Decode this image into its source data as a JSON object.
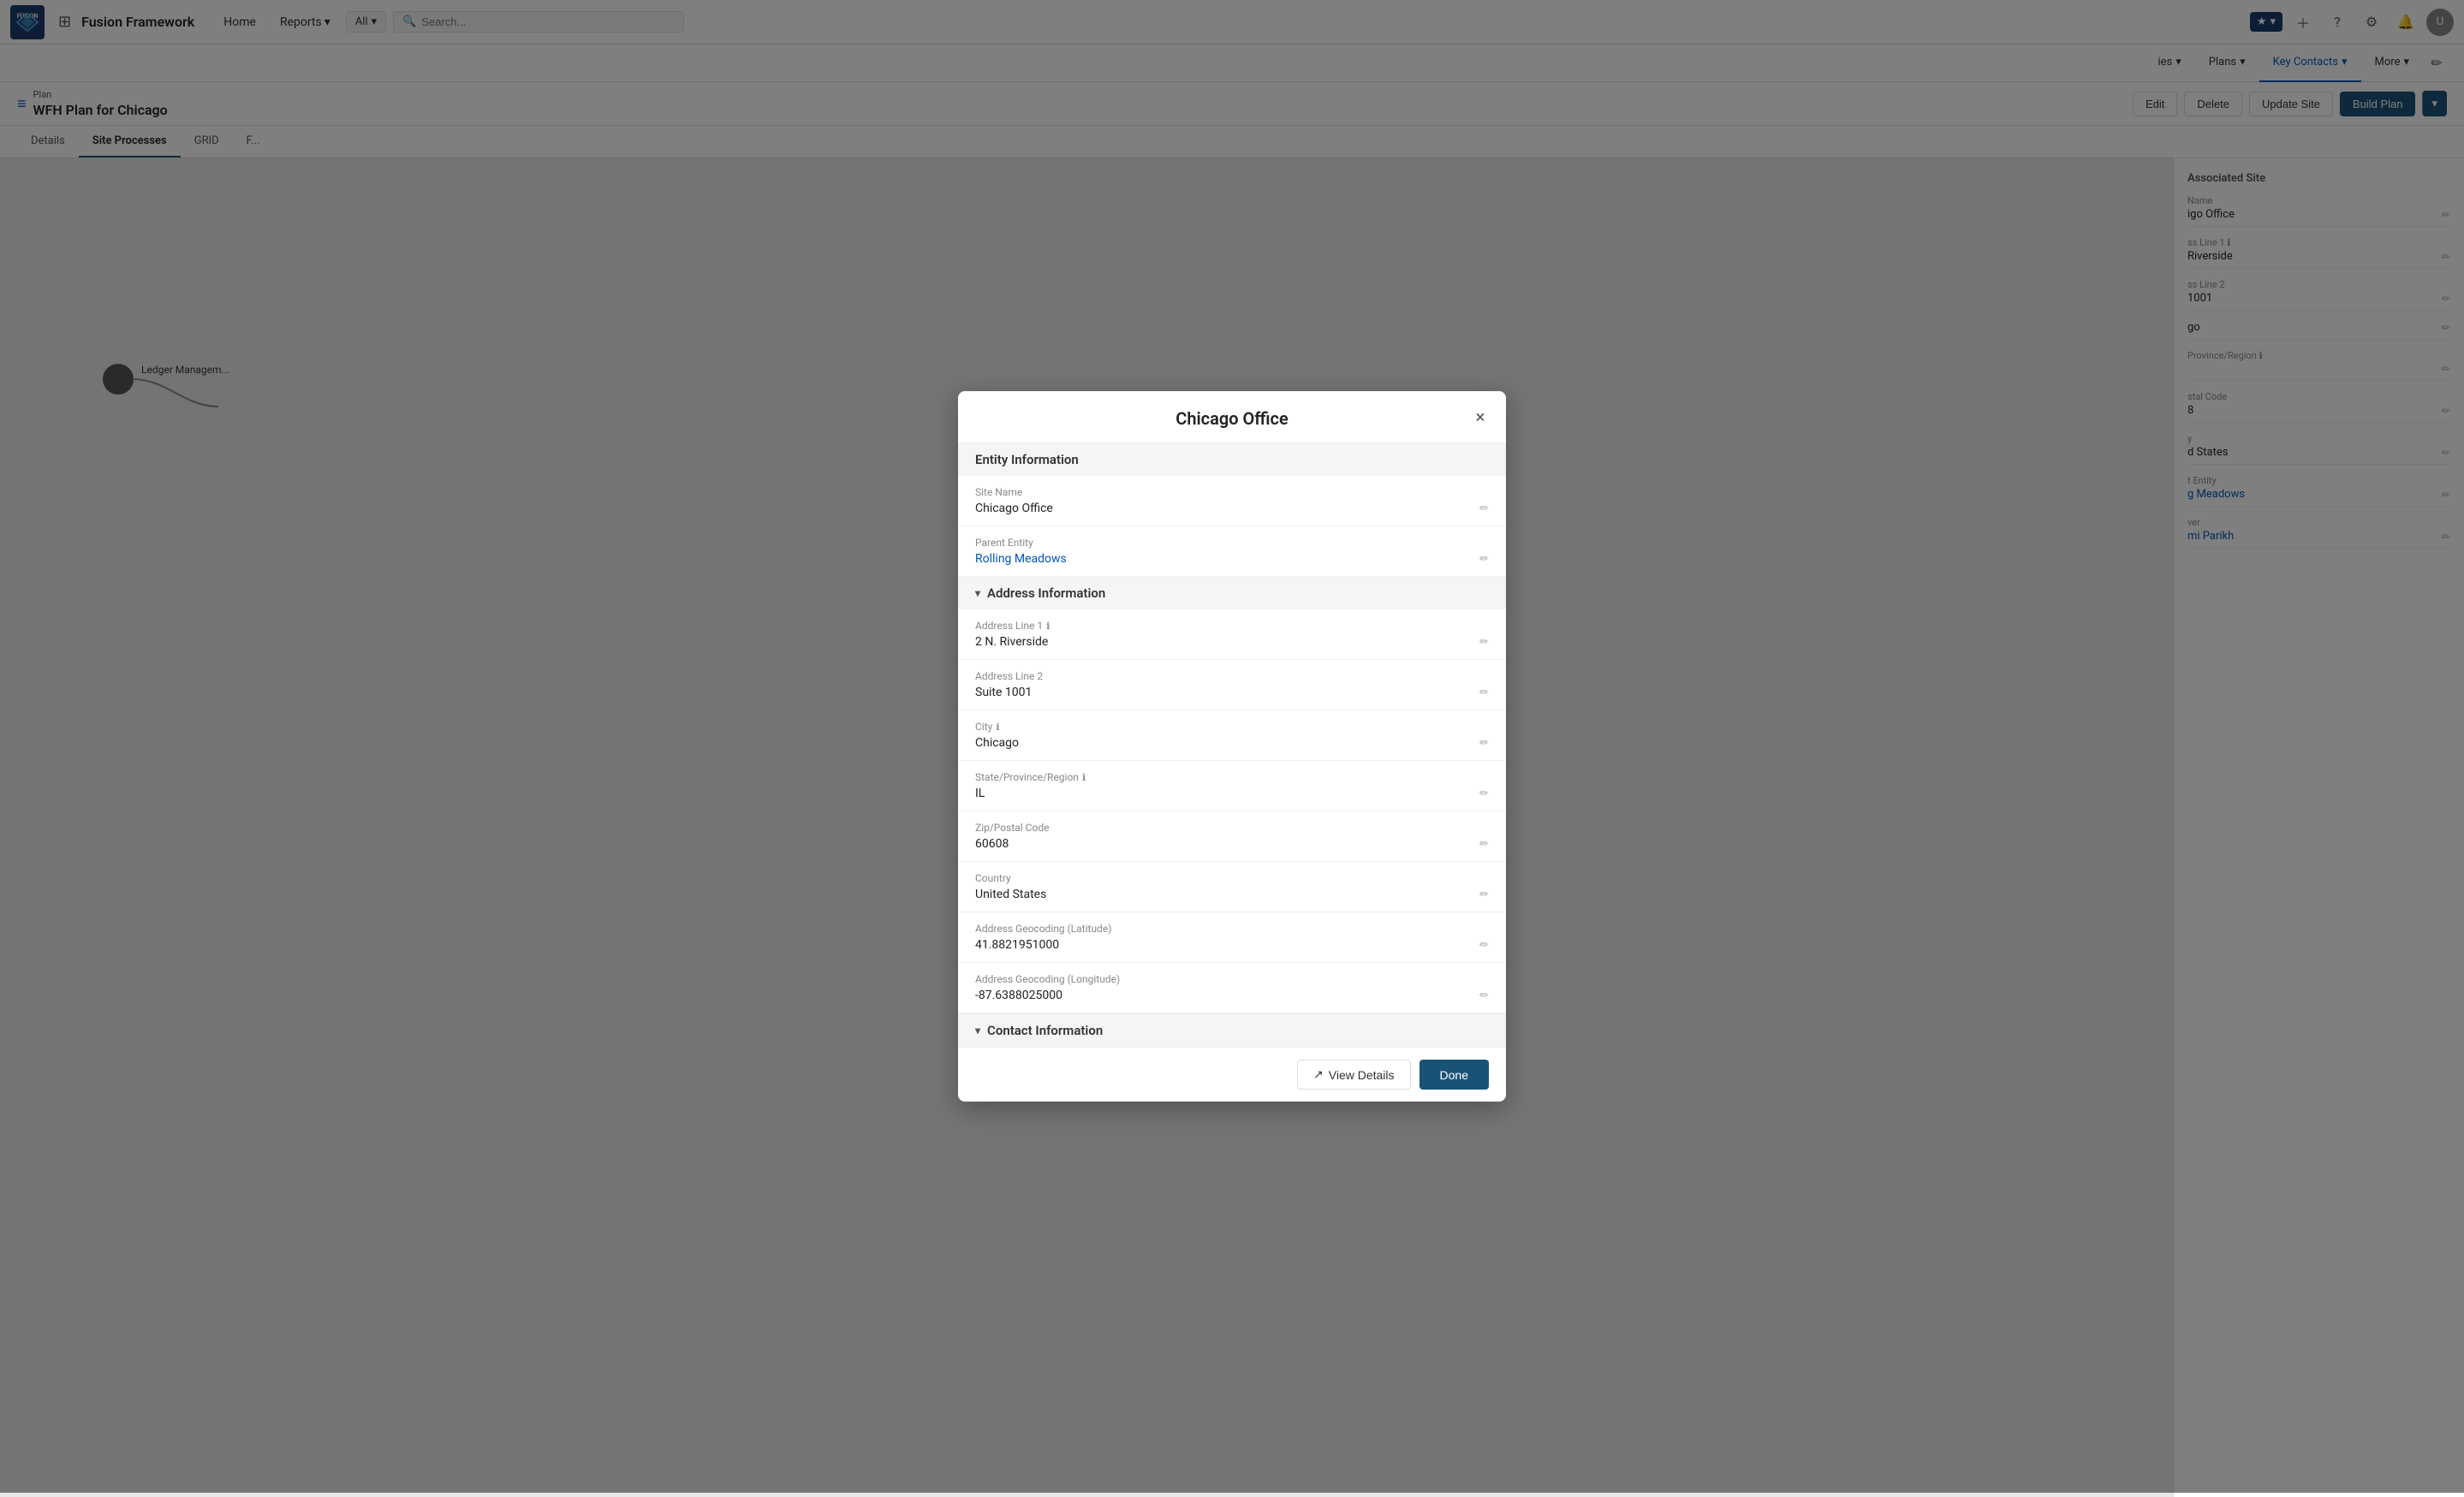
{
  "app": {
    "logo_text": "FUSION",
    "logo_sub": "RISK MANAGEMENT",
    "brand": "Fusion Framework"
  },
  "top_nav": {
    "all_label": "All",
    "search_placeholder": "Search...",
    "home_label": "Home",
    "reports_label": "Reports",
    "plans_label": "Plans",
    "key_contacts_label": "Key Contacts",
    "more_label": "More"
  },
  "breadcrumb": {
    "type": "Plan",
    "title": "WFH Plan for Chicago",
    "edit_label": "Edit",
    "delete_label": "Delete",
    "update_site_label": "Update Site",
    "build_plan_label": "Build Plan"
  },
  "tabs": [
    {
      "label": "Details",
      "active": false
    },
    {
      "label": "Site Processes",
      "active": true
    },
    {
      "label": "GRID",
      "active": false
    },
    {
      "label": "F...",
      "active": false
    }
  ],
  "right_panel": {
    "title": "Associated Site",
    "fields": [
      {
        "label": "Name",
        "value": "igo Office",
        "link": false
      },
      {
        "label": "ss Line 1",
        "value": "Riverside",
        "link": false,
        "info": true
      },
      {
        "label": "ss Line 2",
        "value": "1001",
        "link": false
      },
      {
        "label": "",
        "value": "go",
        "link": false
      },
      {
        "label": "Province/Region",
        "value": "",
        "link": false,
        "info": true
      },
      {
        "label": "stal Code",
        "value": "8",
        "link": false
      },
      {
        "label": "y",
        "value": "d States",
        "link": false
      },
      {
        "label": "t Entity",
        "value": "g Meadows",
        "link": true
      },
      {
        "label": "ver",
        "value": "mi Parikh",
        "link": true
      }
    ]
  },
  "process": {
    "node_label": "",
    "process_label": "Ledger Managem..."
  },
  "modal": {
    "title": "Chicago Office",
    "close_label": "×",
    "sections": [
      {
        "id": "entity",
        "title": "Entity Information",
        "collapsible": false,
        "fields": [
          {
            "label": "Site Name",
            "value": "Chicago Office",
            "info": false,
            "link": false
          },
          {
            "label": "Parent Entity",
            "value": "Rolling Meadows",
            "info": false,
            "link": true
          }
        ]
      },
      {
        "id": "address",
        "title": "Address Information",
        "collapsible": true,
        "fields": [
          {
            "label": "Address Line 1",
            "value": "2 N. Riverside",
            "info": true,
            "link": false
          },
          {
            "label": "Address Line 2",
            "value": "Suite 1001",
            "info": false,
            "link": false
          },
          {
            "label": "City",
            "value": "Chicago",
            "info": true,
            "link": false
          },
          {
            "label": "State/Province/Region",
            "value": "IL",
            "info": true,
            "link": false
          },
          {
            "label": "Zip/Postal Code",
            "value": "60608",
            "info": false,
            "link": false
          },
          {
            "label": "Country",
            "value": "United States",
            "info": false,
            "link": false
          },
          {
            "label": "Address Geocoding (Latitude)",
            "value": "41.8821951000",
            "info": false,
            "link": false
          },
          {
            "label": "Address Geocoding (Longitude)",
            "value": "-87.6388025000",
            "info": false,
            "link": false
          }
        ]
      },
      {
        "id": "contact",
        "title": "Contact Information",
        "collapsible": true,
        "fields": []
      }
    ],
    "footer": {
      "view_details_label": "View Details",
      "done_label": "Done"
    }
  }
}
